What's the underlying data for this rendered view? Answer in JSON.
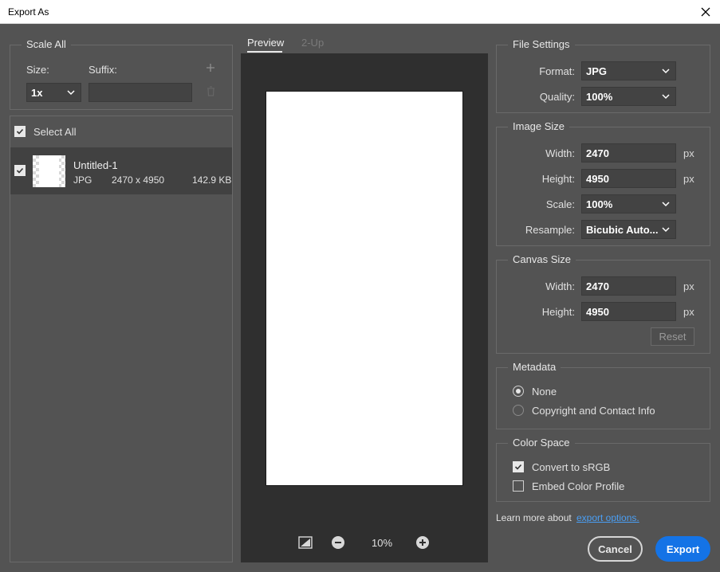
{
  "window": {
    "title": "Export As"
  },
  "scale_all": {
    "legend": "Scale All",
    "size_label": "Size:",
    "suffix_label": "Suffix:",
    "size_value": "1x",
    "suffix_value": "",
    "add_icon": "plus-icon",
    "delete_icon": "trash-icon"
  },
  "asset_list": {
    "select_all_label": "Select All",
    "select_all_checked": true,
    "items": [
      {
        "name": "Untitled-1",
        "format": "JPG",
        "dimensions": "2470 x 4950",
        "size": "142.9 KB",
        "checked": true
      }
    ]
  },
  "preview": {
    "tabs": [
      {
        "label": "Preview",
        "active": true
      },
      {
        "label": "2-Up",
        "active": false
      }
    ],
    "zoom": "10%"
  },
  "file_settings": {
    "legend": "File Settings",
    "format_label": "Format:",
    "format_value": "JPG",
    "quality_label": "Quality:",
    "quality_value": "100%"
  },
  "image_size": {
    "legend": "Image Size",
    "width_label": "Width:",
    "width_value": "2470",
    "height_label": "Height:",
    "height_value": "4950",
    "unit": "px",
    "scale_label": "Scale:",
    "scale_value": "100%",
    "resample_label": "Resample:",
    "resample_value": "Bicubic Auto..."
  },
  "canvas_size": {
    "legend": "Canvas Size",
    "width_label": "Width:",
    "width_value": "2470",
    "height_label": "Height:",
    "height_value": "4950",
    "unit": "px",
    "reset_label": "Reset"
  },
  "metadata": {
    "legend": "Metadata",
    "options": [
      {
        "label": "None",
        "selected": true
      },
      {
        "label": "Copyright and Contact Info",
        "selected": false
      }
    ]
  },
  "color_space": {
    "legend": "Color Space",
    "convert_label": "Convert to sRGB",
    "convert_checked": true,
    "embed_label": "Embed Color Profile",
    "embed_checked": false
  },
  "footer": {
    "learn_more_text": "Learn more about",
    "learn_more_link": "export options.",
    "cancel_label": "Cancel",
    "export_label": "Export"
  },
  "colors": {
    "accent": "#1473e6",
    "link": "#4a9ff5",
    "background": "#535353",
    "preview_bg": "#2f2f2f"
  }
}
